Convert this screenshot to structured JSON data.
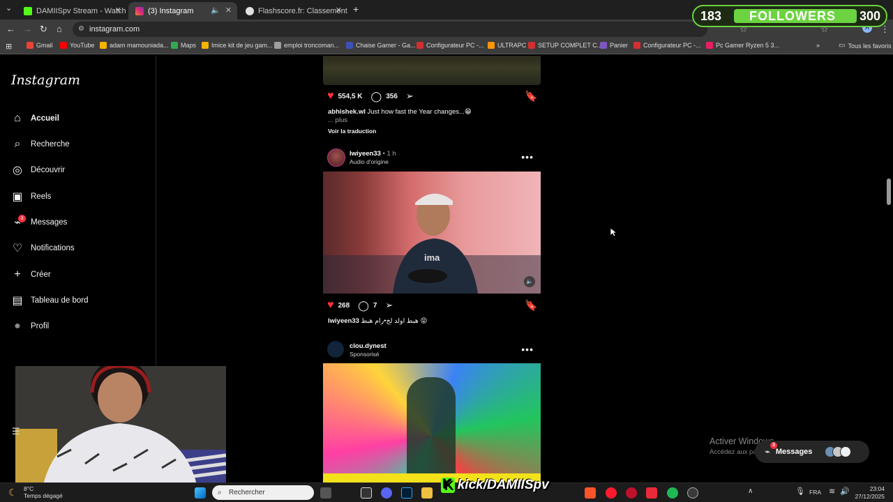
{
  "browser": {
    "tabs": [
      {
        "label": "DAMIISpv Stream - Watch Live",
        "fav_color": "#53fc18"
      },
      {
        "label": "(3) Instagram",
        "fav_color": "#d62976"
      },
      {
        "label": "Flashscore.fr: Classements de C",
        "fav_color": "#e0e0e0"
      }
    ],
    "url": "instagram.com",
    "bookmarks": [
      {
        "label": "Gmail",
        "color": "#ea4335"
      },
      {
        "label": "YouTube",
        "color": "#ff0000"
      },
      {
        "label": "adam mamouniada...",
        "color": "#f4b400"
      },
      {
        "label": "Maps",
        "color": "#34a853"
      },
      {
        "label": "Imice kit de jeu gam...",
        "color": "#f4b400"
      },
      {
        "label": "emploi troncoman...",
        "color": "#9e9e9e"
      },
      {
        "label": "Chaise Gamer - Ga...",
        "color": "#3f51b5"
      },
      {
        "label": "Configurateur PC -...",
        "color": "#d32f2f"
      },
      {
        "label": "ULTRAPC",
        "color": "#ff9800"
      },
      {
        "label": "SETUP COMPLET C...",
        "color": "#d32f2f"
      },
      {
        "label": "Panier",
        "color": "#7e57c2"
      },
      {
        "label": "Configurateur PC -...",
        "color": "#d32f2f"
      },
      {
        "label": "Pc Gamer Ryzen 5 3...",
        "color": "#e91e63"
      }
    ],
    "all_favorites": "Tous les favoris"
  },
  "followers_overlay": {
    "current": "183",
    "label": "FOLLOWERS",
    "goal": "300"
  },
  "sidebar": {
    "logo": "Instagram",
    "items": [
      {
        "label": "Accueil",
        "icon": "home-icon",
        "bold": true
      },
      {
        "label": "Recherche",
        "icon": "search-icon"
      },
      {
        "label": "Découvrir",
        "icon": "compass-icon"
      },
      {
        "label": "Reels",
        "icon": "reels-icon"
      },
      {
        "label": "Messages",
        "icon": "messenger-icon",
        "badge": "3"
      },
      {
        "label": "Notifications",
        "icon": "heart-icon"
      },
      {
        "label": "Créer",
        "icon": "plus-icon"
      },
      {
        "label": "Tableau de bord",
        "icon": "dashboard-icon"
      },
      {
        "label": "Profil",
        "icon": "avatar-icon"
      }
    ]
  },
  "feed": {
    "post1": {
      "likes": "554,5 K",
      "comments": "356",
      "username": "abhishek.wl",
      "caption": "Just how fast the Year changes...😁",
      "more": "... plus",
      "translate": "Voir la traduction"
    },
    "post2": {
      "username": "lwiyeen33",
      "time": "• 1 h",
      "audio": "Audio d'origine",
      "likes": "268",
      "comments": "7",
      "caption": "هبط اولد لخ•رام هبط 😝"
    },
    "post3": {
      "username": "clou.dynest",
      "sponsored": "Sponsorisé"
    }
  },
  "overlays": {
    "kick_handle": "kick/DAMIISpv",
    "kick_logo": "K",
    "activate_title": "Activer Windows",
    "activate_sub": "Accédez aux paramètres pour activer W",
    "messages_pill": "Messages",
    "messages_badge": "3"
  },
  "taskbar": {
    "weather_temp": "8°C",
    "weather_desc": "Temps dégagé",
    "search_placeholder": "Rechercher",
    "language": "FRA",
    "time": "23:04",
    "date": "27/12/2025"
  }
}
